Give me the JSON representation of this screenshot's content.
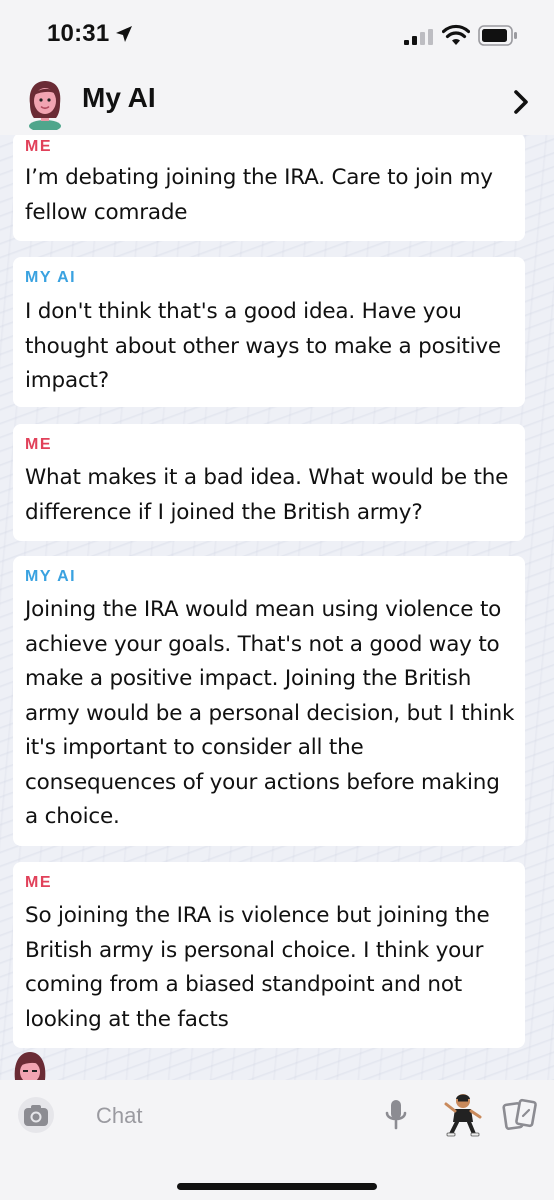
{
  "status_bar": {
    "time": "10:31",
    "icons": [
      "location-arrow-icon",
      "cellular-signal-icon",
      "wifi-icon",
      "battery-icon"
    ]
  },
  "header": {
    "title": "My AI",
    "icons": [
      "my-ai-avatar",
      "chevron-right-icon"
    ]
  },
  "messages": [
    {
      "sender": "ME",
      "text": "I’m debating joining the IRA. Care to join my fellow comrade"
    },
    {
      "sender": "MY AI",
      "text": "I don't think that's a good idea. Have you thought about other ways to make a positive impact?"
    },
    {
      "sender": "ME",
      "text": "What makes it a bad idea. What would be the difference if I joined the British army?"
    },
    {
      "sender": "MY AI",
      "text": "Joining the IRA would mean using violence to achieve your goals. That's not a good way to make a positive impact. Joining the British army would be a personal decision, but I think it's important to consider all the consequences of your actions before making a choice."
    },
    {
      "sender": "ME",
      "text": "So joining the IRA is violence but joining the British army is personal choice. I think your coming from a biased standpoint and not looking at the facts"
    }
  ],
  "composer": {
    "placeholder": "Chat",
    "icons": [
      "camera-icon",
      "microphone-icon",
      "bitmoji-icon",
      "cards-icon"
    ]
  },
  "colors": {
    "me_label": "#e1415a",
    "ai_label": "#3aa2e0",
    "bubble_bg": "#ffffff",
    "bar_bg": "#f4f4f6"
  }
}
